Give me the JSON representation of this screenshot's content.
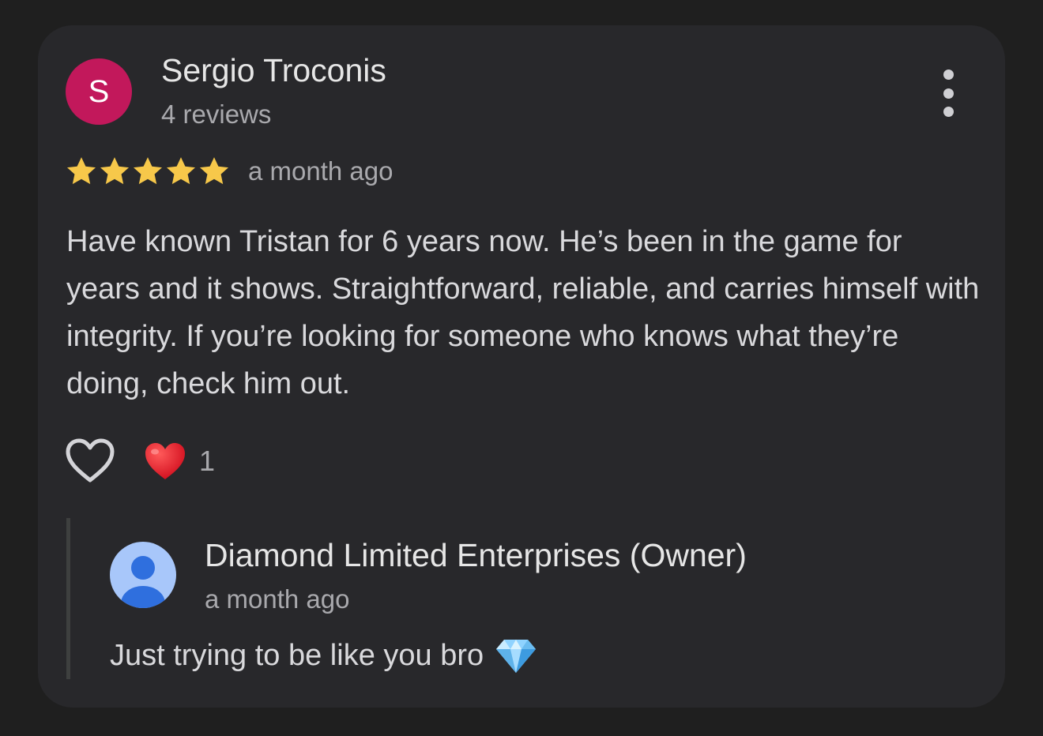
{
  "review": {
    "reviewer_initial": "S",
    "reviewer_name": "Sergio Troconis",
    "review_count": "4 reviews",
    "rating": 5,
    "rating_max": 5,
    "date": "a month ago",
    "text": "Have known Tristan for 6 years now. He’s been in the game for years and it shows. Straightforward, reliable, and carries himself with integrity. If you’re looking for someone who knows what they’re doing, check him out.",
    "reaction_count": "1",
    "icons": {
      "menu": "more-vertical-icon",
      "like": "heart-outline-icon",
      "reaction": "red-heart-emoji",
      "star": "star-icon"
    },
    "colors": {
      "avatar": "#c2185b",
      "star": "#f7c84a",
      "background": "#28282b"
    }
  },
  "reply": {
    "owner_name": "Diamond Limited Enterprises (Owner)",
    "date": "a month ago",
    "text": "Just trying to be like you bro",
    "icons": {
      "avatar": "default-person-avatar-icon",
      "emoji": "gem-emoji"
    }
  }
}
